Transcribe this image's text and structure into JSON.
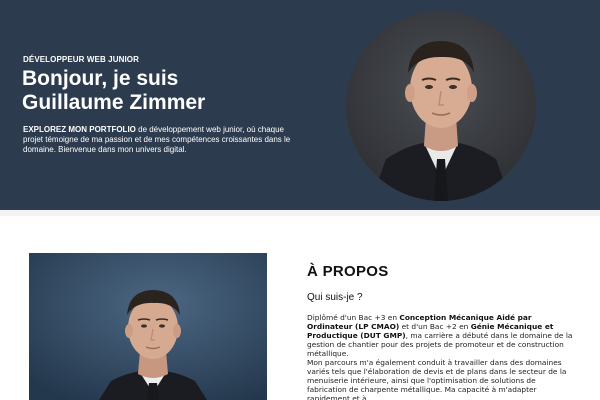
{
  "hero": {
    "subtitle": "DÉVELOPPEUR WEB JUNIOR",
    "title_line1": "Bonjour, je suis",
    "title_line2": "Guillaume Zimmer",
    "desc_bold": "EXPLOREZ MON PORTFOLIO",
    "desc_rest": " de développement web junior, où chaque projet témoigne de ma passion et de mes compétences croissantes dans le domaine. Bienvenue dans mon univers digital.",
    "avatar_icon": "profile-photo"
  },
  "about": {
    "title": "À PROPOS",
    "question": "Qui suis-je ?",
    "p1_a": "Diplômé d'un Bac +3 en ",
    "p1_b": "Conception Mécanique Aidé par Ordinateur (LP CMAO)",
    "p1_c": " et d'un Bac +2 en ",
    "p1_d": "Génie Mécanique et Productique (DUT GMP)",
    "p1_e": ", ma carrière a débuté dans le domaine de la gestion de chantier pour des projets de promoteur et de construction métallique.",
    "p2": "Mon parcours m'a également conduit à travailler dans des domaines variés tels que l'élaboration de devis et de plans dans le secteur de la menuiserie intérieure, ainsi que l'optimisation de solutions de fabrication de charpente métallique. Ma capacité à m'adapter rapidement et à"
  },
  "colors": {
    "hero_bg": "#2c3b4e",
    "text_dark": "#111111"
  }
}
